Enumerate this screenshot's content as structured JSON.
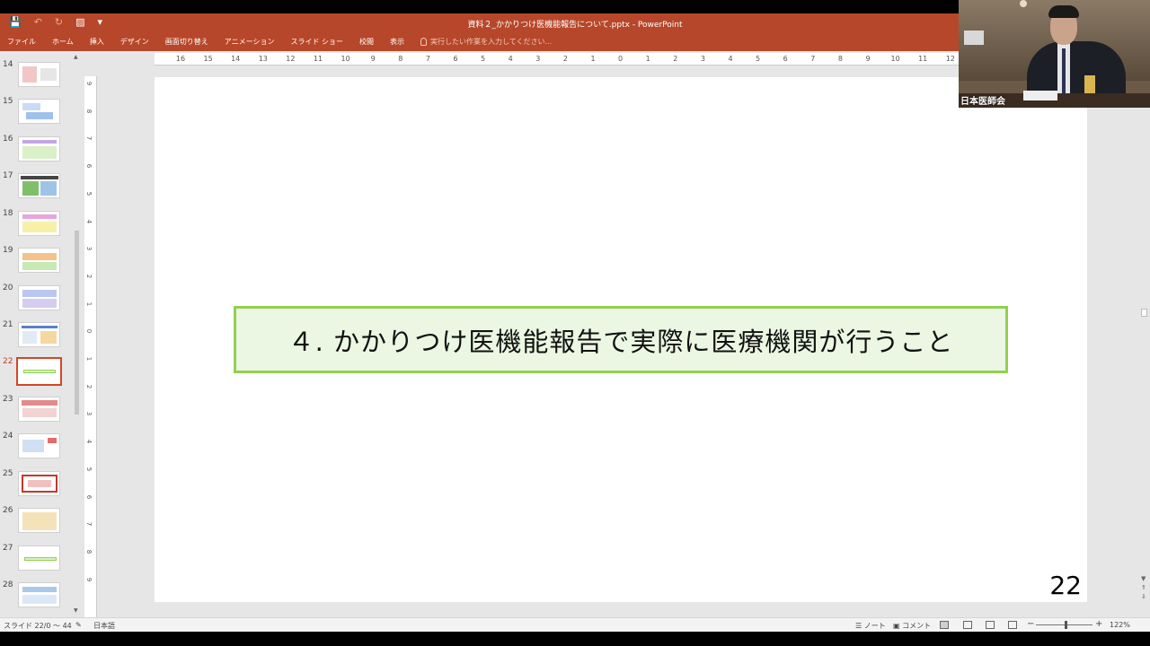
{
  "window": {
    "title": "資料２_かかりつけ医機能報告について.pptx - PowerPoint",
    "qat": {
      "save_icon": "save-icon",
      "undo_icon": "undo-icon",
      "redo_icon": "redo-icon",
      "present_icon": "present-from-start-icon",
      "customize_icon": "customize-qat-icon"
    }
  },
  "ribbon": {
    "tabs": [
      "ファイル",
      "ホーム",
      "挿入",
      "デザイン",
      "画面切り替え",
      "アニメーション",
      "スライド ショー",
      "校閲",
      "表示"
    ],
    "tell_me_placeholder": "実行したい作業を入力してください..."
  },
  "thumbnails": {
    "numbers": [
      "14",
      "15",
      "16",
      "17",
      "18",
      "19",
      "20",
      "21",
      "22",
      "23",
      "24",
      "25",
      "26",
      "27",
      "28"
    ],
    "active": "22"
  },
  "ruler": {
    "horizontal": [
      "16",
      "15",
      "14",
      "13",
      "12",
      "11",
      "10",
      "9",
      "8",
      "7",
      "6",
      "5",
      "4",
      "3",
      "2",
      "1",
      "0",
      "1",
      "2",
      "3",
      "4",
      "5",
      "6",
      "7",
      "8",
      "9",
      "10",
      "11",
      "12"
    ],
    "vertical": [
      "9",
      "8",
      "7",
      "6",
      "5",
      "4",
      "3",
      "2",
      "1",
      "0",
      "1",
      "2",
      "3",
      "4",
      "5",
      "6",
      "7",
      "8",
      "9"
    ]
  },
  "slide": {
    "heading": "４. かかりつけ医機能報告で実際に医療機関が行うこと",
    "page_number": "22",
    "heading_fill": "#ebf7e3",
    "heading_border": "#92d050"
  },
  "status": {
    "slide_info": "スライド 22/0 ～ 44",
    "language": "日本語",
    "notes": "ノート",
    "comments": "コメント",
    "zoom": "122%"
  },
  "video": {
    "caption": "日本医師会"
  },
  "colors": {
    "accent": "#b7472a",
    "active_thumb": "#d24726"
  }
}
